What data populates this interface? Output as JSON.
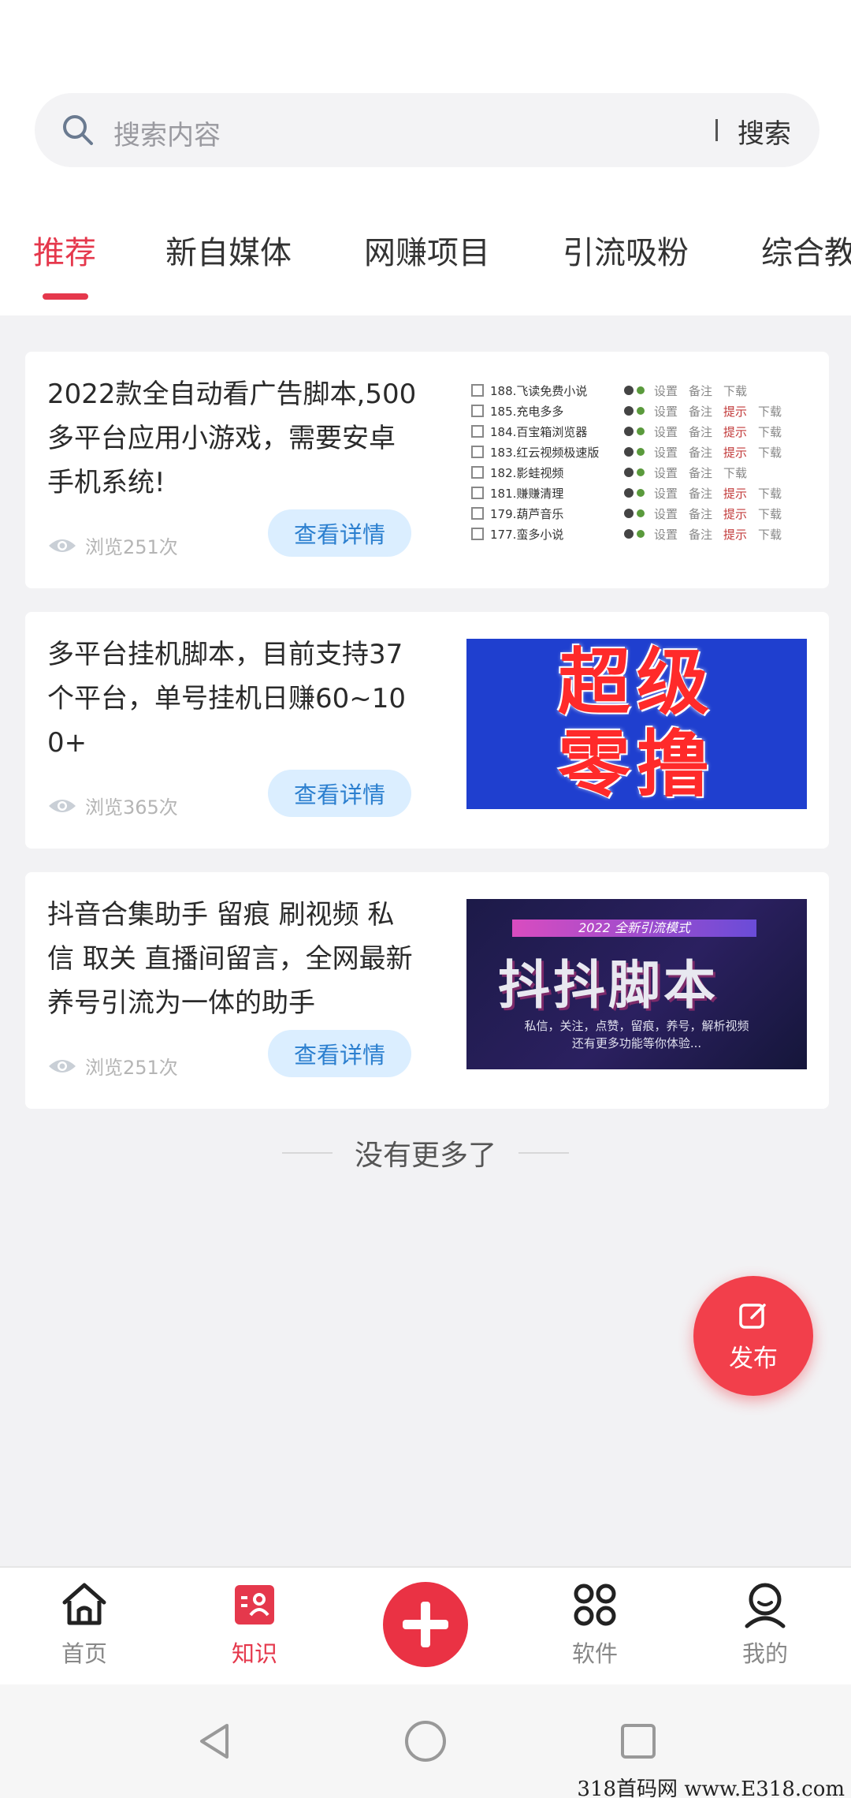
{
  "search": {
    "placeholder": "搜索内容",
    "button_label": "搜索"
  },
  "tabs": [
    {
      "label": "推荐",
      "active": true
    },
    {
      "label": "新自媒体",
      "active": false
    },
    {
      "label": "网赚项目",
      "active": false
    },
    {
      "label": "引流吸粉",
      "active": false
    },
    {
      "label": "综合教",
      "active": false
    }
  ],
  "cards": [
    {
      "title": "2022款全自动看广告脚本,500多平台应用小游戏，需要安卓手机系统!",
      "views": "浏览251次",
      "button_label": "查看详情",
      "thumb_rows": [
        {
          "name": "188.飞读免费小说",
          "a1": "设置",
          "a2": "备注",
          "a3": "下载",
          "highlight": false
        },
        {
          "name": "185.充电多多",
          "a1": "设置",
          "a2": "备注",
          "a3": "提示",
          "a4": "下载",
          "highlight": true
        },
        {
          "name": "184.百宝箱浏览器",
          "a1": "设置",
          "a2": "备注",
          "a3": "提示",
          "a4": "下载",
          "highlight": true
        },
        {
          "name": "183.红云视频极速版",
          "a1": "设置",
          "a2": "备注",
          "a3": "提示",
          "a4": "下载",
          "highlight": true
        },
        {
          "name": "182.影蛙视频",
          "a1": "设置",
          "a2": "备注",
          "a3": "下载",
          "highlight": false
        },
        {
          "name": "181.赚赚清理",
          "a1": "设置",
          "a2": "备注",
          "a3": "提示",
          "a4": "下载",
          "highlight": true
        },
        {
          "name": "179.葫芦音乐",
          "a1": "设置",
          "a2": "备注",
          "a3": "提示",
          "a4": "下载",
          "highlight": true
        },
        {
          "name": "177.蛮多小说",
          "a1": "设置",
          "a2": "备注",
          "a3": "提示",
          "a4": "下载",
          "highlight": true
        }
      ]
    },
    {
      "title": "多平台挂机脚本，目前支持37个平台，单号挂机日赚60~100+",
      "views": "浏览365次",
      "button_label": "查看详情",
      "thumb_line1": "超级",
      "thumb_line2": "零撸"
    },
    {
      "title": "抖音合集助手 留痕 刷视频 私信 取关 直播间留言，全网最新养号引流为一体的助手",
      "views": "浏览251次",
      "button_label": "查看详情",
      "thumb_ribbon": "2022 全新引流模式",
      "thumb_big": "抖抖脚本",
      "thumb_sub1": "私信，关注，点赞，留痕，养号，解析视频",
      "thumb_sub2": "还有更多功能等你体验..."
    }
  ],
  "no_more": "没有更多了",
  "fab": {
    "label": "发布",
    "icon": "edit-icon"
  },
  "bottom_nav": [
    {
      "label": "首页",
      "icon": "home-icon",
      "active": false
    },
    {
      "label": "知识",
      "icon": "knowledge-icon",
      "active": true
    },
    {
      "label": "",
      "icon": "plus-icon",
      "active": false
    },
    {
      "label": "软件",
      "icon": "apps-icon",
      "active": false
    },
    {
      "label": "我的",
      "icon": "profile-icon",
      "active": false
    }
  ],
  "watermark": "318首码网 www.E318.com",
  "colors": {
    "accent": "#e5384c",
    "button_bg": "#dbeeff",
    "button_text": "#2b7fcf",
    "fab": "#f23f4b"
  }
}
